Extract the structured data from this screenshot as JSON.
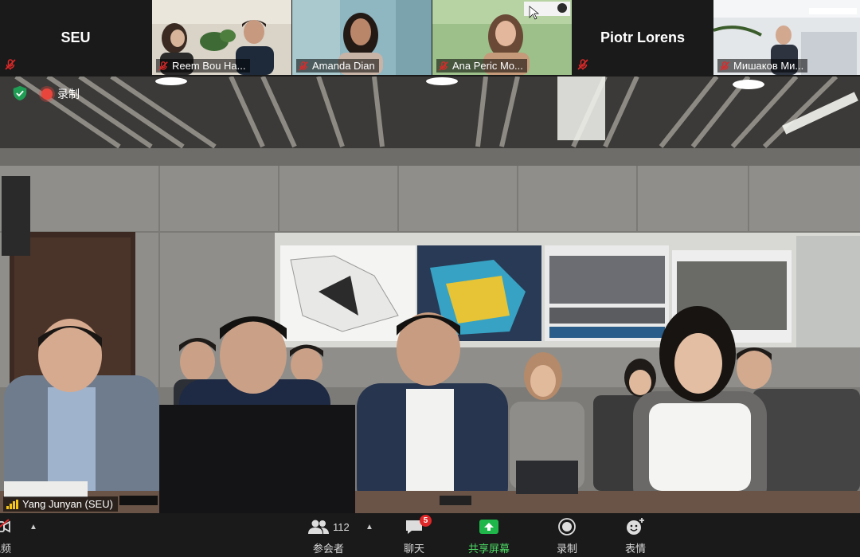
{
  "participants": [
    {
      "type": "name",
      "name": "SEU",
      "muted": true
    },
    {
      "type": "video",
      "name": "Reem Bou Ha...",
      "muted": true
    },
    {
      "type": "video",
      "name": "Amanda Dian",
      "muted": true
    },
    {
      "type": "video",
      "name": "Ana Peric Mo...",
      "muted": true
    },
    {
      "type": "name",
      "name": "Piotr Lorens",
      "muted": true
    },
    {
      "type": "video",
      "name": "Мишаков Ми...",
      "muted": true
    }
  ],
  "main_video": {
    "recording_label": "录制",
    "speaker_name": "Yang Junyan (SEU)"
  },
  "toolbar": {
    "video_label": "视频",
    "participants_label": "参会者",
    "participants_count": "112",
    "chat_label": "聊天",
    "chat_badge": "5",
    "share_label": "共享屏幕",
    "record_label": "录制",
    "reactions_label": "表情"
  },
  "colors": {
    "background": "#1a1a1a",
    "share_green": "#4cd964",
    "mute_red": "#e02828",
    "record_red": "#e8453c",
    "security_green": "#1f9d55"
  }
}
